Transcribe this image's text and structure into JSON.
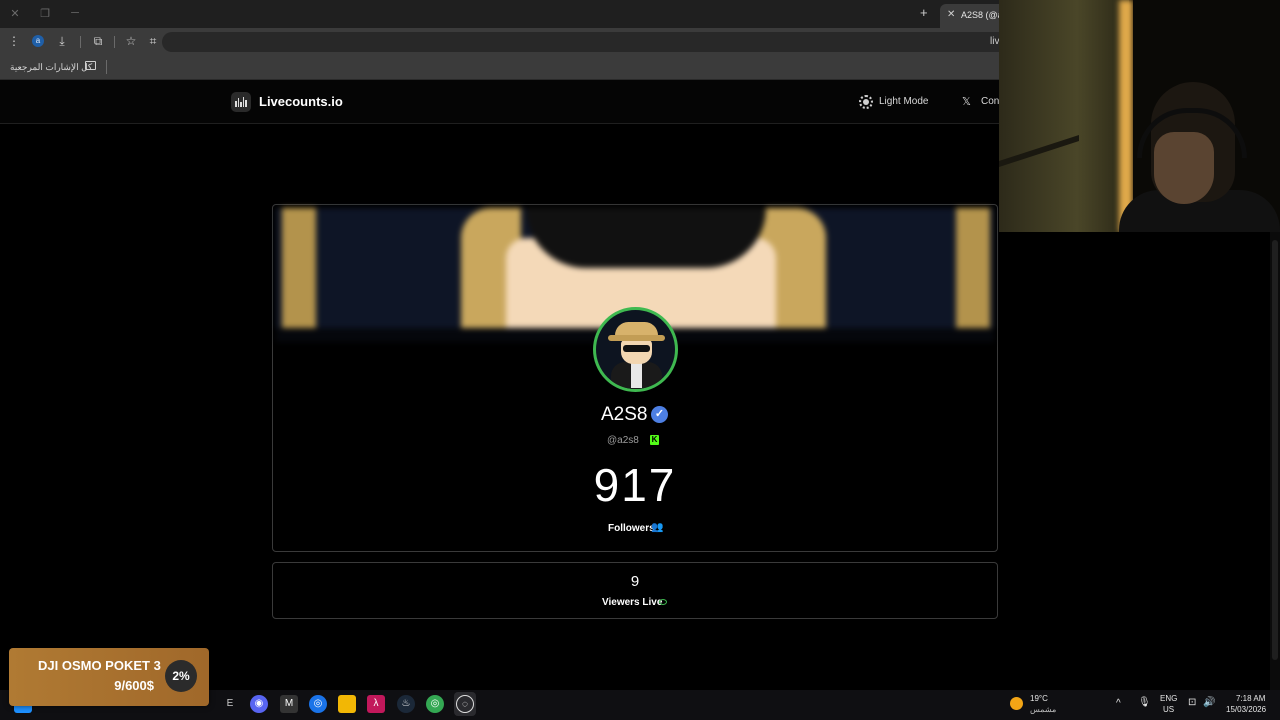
{
  "browser": {
    "tab_title": "A2S8 (@a2",
    "address_text": "liv",
    "bookmarks_label": "كل الإشارات المرجعية",
    "profile_letter": "a"
  },
  "site": {
    "name": "Livecounts.io",
    "light_mode_label": "Light Mode",
    "contact_label": "Con"
  },
  "profile": {
    "username": "A2S8",
    "handle": "@a2s8",
    "followers_count": "917",
    "followers_label": "Followers",
    "viewers_count": "9",
    "viewers_label": "Viewers Live",
    "ring_color": "#3fb950",
    "verified_color": "#4d7fe3",
    "platform_icon": "kick-icon"
  },
  "donation_goal": {
    "title": "DJI OSMO POKET 3",
    "amount": "9/600$",
    "percent": "2%",
    "progress": 0.02
  },
  "taskbar": {
    "weather_temp": "19°C",
    "weather_desc": "مشمس",
    "lang_top": "ENG",
    "lang_bottom": "US",
    "time": "7:18 AM",
    "date": "15/03/2026"
  }
}
